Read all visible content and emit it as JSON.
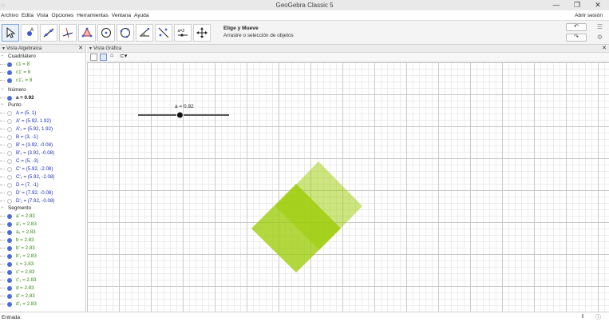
{
  "window": {
    "title": "GeoGebra Classic 5",
    "minimize": "—",
    "maximize": "❐",
    "close": "✕"
  },
  "menu": {
    "items": [
      "Archivo",
      "Edita",
      "Vista",
      "Opciones",
      "Herramientas",
      "Ventana",
      "Ayuda"
    ],
    "login": "Abrir sesión"
  },
  "toolbar": {
    "tools": [
      "move-tool",
      "point-tool",
      "line-tool",
      "perpendicular-tool",
      "polygon-tool",
      "circle-tool",
      "conic-tool",
      "angle-tool",
      "reflect-tool",
      "slider-tool",
      "move-graphics-tool"
    ],
    "selected_tool_name": "Elige y Mueve",
    "selected_tool_help": "Arrastre o selección de objetos",
    "slider_icon_text": "a=2"
  },
  "algebra": {
    "title": "Vista Algebraica",
    "categories": {
      "cuadrilatero": "Cuadrilátero",
      "numero": "Número",
      "punto": "Punto",
      "segmento": "Segmento"
    },
    "cuadrilatero": [
      "c1 = 8",
      "c1' = 8",
      "c1'₁ = 8"
    ],
    "numero": [
      "a = 0.92"
    ],
    "punto": [
      "A = (5, 1)",
      "A' = (5.92, 1.92)",
      "A'₁ = (5.92, 1.92)",
      "B = (3, -1)",
      "B' = (3.92, -0.08)",
      "B'₁ = (3.92, -0.08)",
      "C = (5, -3)",
      "C' = (5.92, -2.08)",
      "C'₁ = (5.92, -2.08)",
      "D = (7, -1)",
      "D' = (7.92, -0.08)",
      "D'₁ = (7.92, -0.08)"
    ],
    "segmento": [
      "a' = 2.83",
      "a'₁ = 2.83",
      "a₁ = 2.83",
      "b = 2.83",
      "b' = 2.83",
      "b'₁ = 2.83",
      "c = 2.83",
      "c' = 2.83",
      "c'₁ = 2.83",
      "d = 2.83",
      "d' = 2.83",
      "d'₁ = 2.83"
    ]
  },
  "graphics": {
    "title": "Vista Gráfica",
    "slider_label": "a = 0.92",
    "slider_value": 0.92,
    "fill_color": "#99cc00"
  },
  "input": {
    "label": "Entrada:"
  }
}
